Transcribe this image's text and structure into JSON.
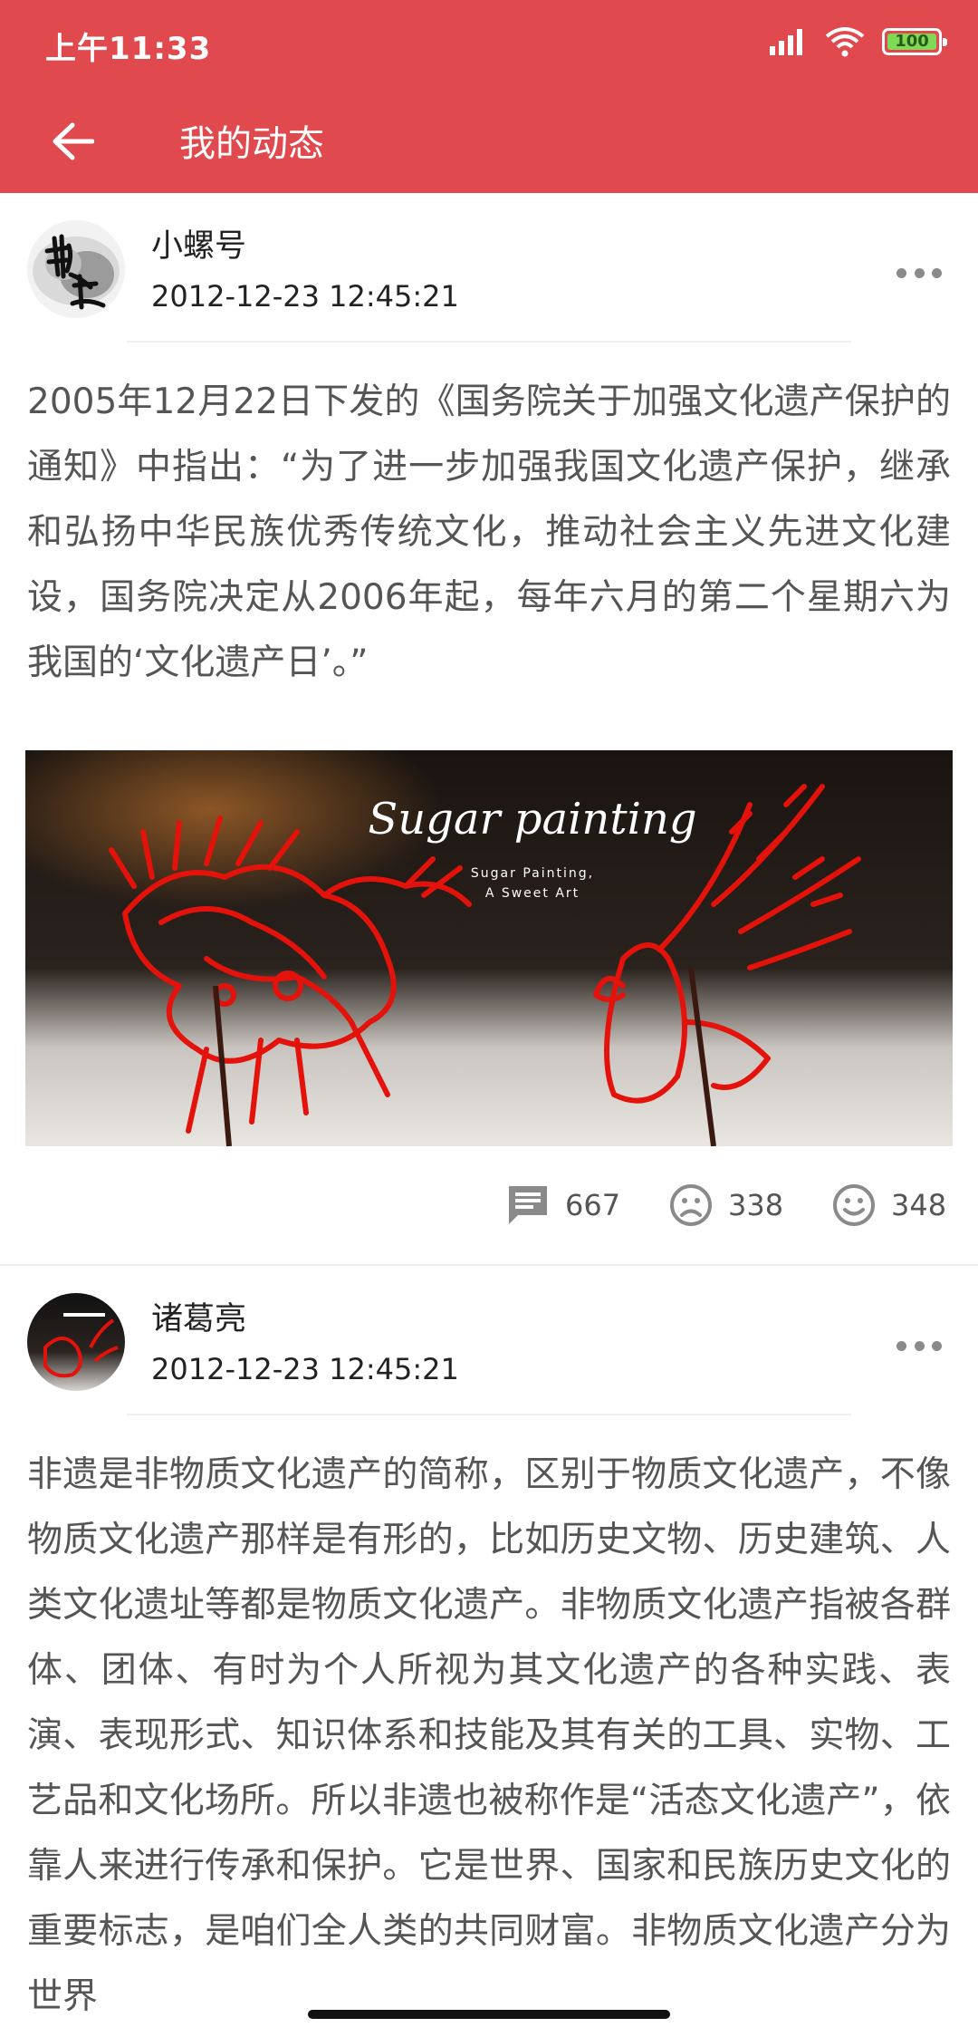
{
  "status_bar": {
    "time": "上午11:33",
    "battery": "100"
  },
  "app_bar": {
    "title": "我的动态"
  },
  "posts": [
    {
      "username": "小螺号",
      "timestamp": "2012-12-23 12:45:21",
      "text": "2005年12月22日下发的《国务院关于加强文化遗产保护的通知》中指出：“为了进一步加强我国文化遗产保护，继承和弘扬中华民族优秀传统文化，推动社会主义先进文化建设，国务院决定从2006年起，每年六月的第二个星期六为我国的‘文化遗产日’。”",
      "image": {
        "title": "Sugar painting",
        "subtitle_line1": "Sugar Painting,",
        "subtitle_line2": "A Sweet Art"
      },
      "comments": "667",
      "dislikes": "338",
      "likes": "348"
    },
    {
      "username": "诸葛亮",
      "timestamp": "2012-12-23 12:45:21",
      "text": "非遗是非物质文化遗产的简称，区别于物质文化遗产，不像物质文化遗产那样是有形的，比如历史文物、历史建筑、人类文化遗址等都是物质文化遗产。非物质文化遗产指被各群体、团体、有时为个人所视为其文化遗产的各种实践、表演、表现形式、知识体系和技能及其有关的工具、实物、工艺品和文化场所。所以非遗也被称作是“活态文化遗产”，依靠人来进行传承和保护。它是世界、国家和民族历史文化的重要标志，是咱们全人类的共同财富。非物质文化遗产分为世界"
    }
  ],
  "colors": {
    "primary": "#e0494d",
    "text_secondary": "#555555",
    "icon_gray": "#8a8a8a"
  }
}
